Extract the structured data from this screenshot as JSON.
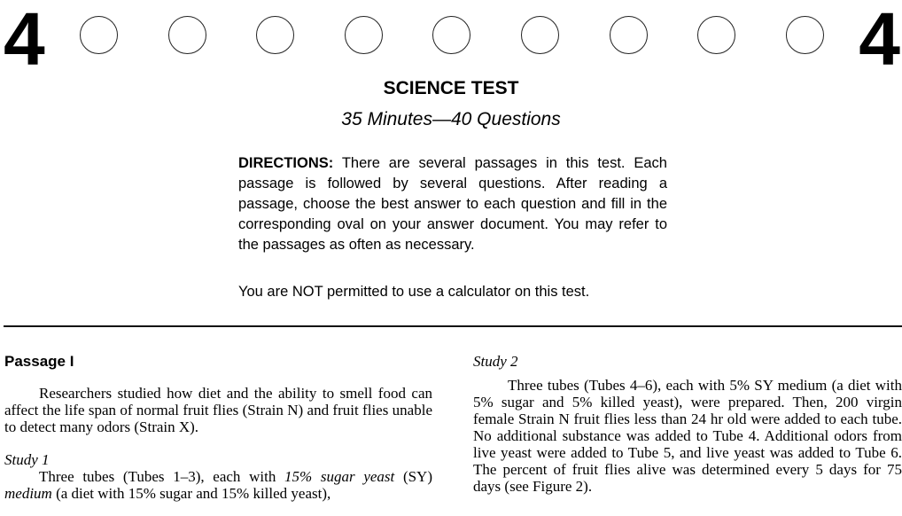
{
  "header": {
    "page_number_left": "4",
    "page_number_right": "4",
    "answer_ovals": 9
  },
  "title": "SCIENCE TEST",
  "subtitle": "35 Minutes—40 Questions",
  "directions": {
    "label": "DIRECTIONS:",
    "text": " There are several passages in this test. Each passage is followed by several questions. After reading a passage, choose the best answer to each question and fill in the corresponding oval on your answer document. You may refer to the passages as often as necessary.",
    "calculator_note": "You are NOT permitted to use a calculator on this test."
  },
  "passage": {
    "title": "Passage I",
    "intro": "Researchers studied how diet and the ability to smell food can affect the life span of normal fruit flies (Strain N) and fruit flies unable to detect many odors (Strain X).",
    "study1": {
      "heading": "Study 1",
      "text_a": "Three tubes (Tubes 1–3), each with ",
      "text_italic_1": "15% sugar yeast",
      "text_b": " (SY) ",
      "text_italic_2": "medium",
      "text_c": " (a diet with 15% sugar and 15% killed yeast),"
    },
    "study2": {
      "heading": "Study 2",
      "text": "Three tubes (Tubes 4–6), each with 5% SY medium (a diet with 5% sugar and 5% killed yeast), were prepared. Then, 200 virgin female Strain N fruit flies less than 24 hr old were added to each tube. No additional substance was added to Tube 4. Additional odors from live yeast were added to Tube 5, and live yeast was added to Tube 6. The percent of fruit flies alive was determined every 5 days for 75 days (see Figure 2)."
    }
  }
}
